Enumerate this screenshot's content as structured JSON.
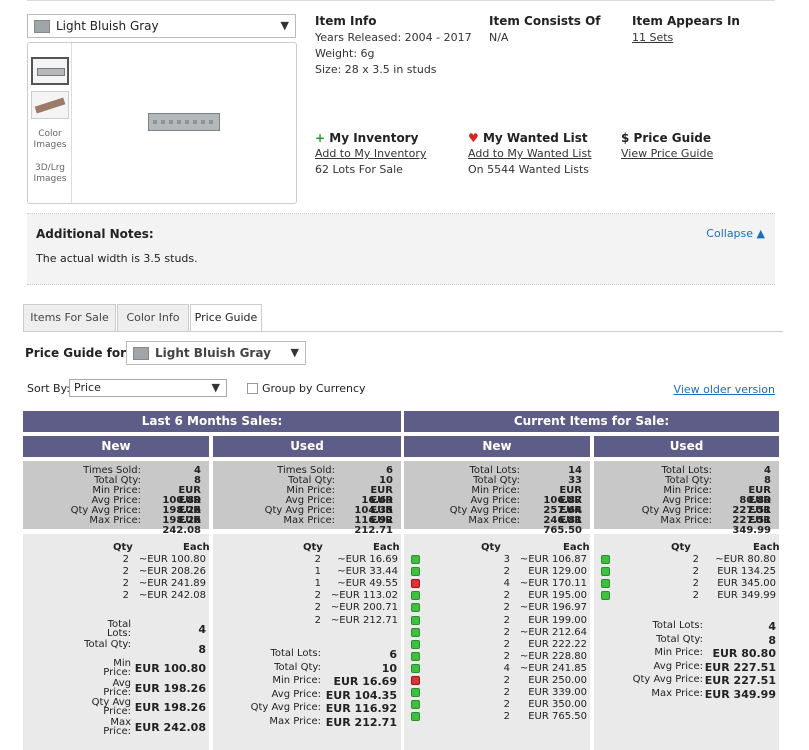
{
  "header": {
    "color_select": "Light Bluish Gray",
    "thumb_color_images": "Color Images",
    "thumb_3d_images": "3D/Lrg Images"
  },
  "item_info": {
    "title": "Item Info",
    "years": "Years Released: 2004 - 2017",
    "weight": "Weight: 6g",
    "size": "Size: 28 x 3.5 in studs"
  },
  "consists": {
    "title": "Item Consists Of",
    "value": "N/A"
  },
  "appears": {
    "title": "Item Appears In",
    "link": "11 Sets"
  },
  "inventory": {
    "icon": "+",
    "title": "My Inventory",
    "link": "Add to My Inventory",
    "sub": "62 Lots For Sale"
  },
  "wanted": {
    "icon": "♥",
    "title": "My Wanted List",
    "link": "Add to My Wanted List",
    "sub": "On 5544 Wanted Lists"
  },
  "price_guide_box": {
    "icon": "$",
    "title": "Price Guide",
    "link": "View Price Guide"
  },
  "notes": {
    "title": "Additional Notes:",
    "text": "The actual width is 3.5 studs.",
    "collapse": "Collapse ▲"
  },
  "tabs": [
    "Items For Sale",
    "Color Info",
    "Price Guide"
  ],
  "price_guide": {
    "title": "Price Guide for",
    "color": "Light Bluish Gray",
    "sort_label": "Sort By:",
    "sort_value": "Price",
    "group_label": "Group by Currency",
    "older_link": "View older version",
    "band_left": "Last 6 Months Sales:",
    "band_right": "Current Items for Sale:",
    "new_label": "New",
    "used_label": "Used"
  },
  "summary_labels": {
    "sold": [
      "Times Sold:",
      "Total Qty:",
      "Min Price:",
      "Avg Price:",
      "Qty Avg Price:",
      "Max Price:"
    ],
    "current": [
      "Total Lots:",
      "Total Qty:",
      "Min Price:",
      "Avg Price:",
      "Qty Avg Price:",
      "Max Price:"
    ]
  },
  "summaries": {
    "sold_new": [
      "4",
      "8",
      "EUR 100.80",
      "EUR 198.26",
      "EUR 198.26",
      "EUR 242.08"
    ],
    "sold_used": [
      "6",
      "10",
      "EUR 16.69",
      "EUR 104.35",
      "EUR 116.92",
      "EUR 212.71"
    ],
    "cur_new": [
      "14",
      "33",
      "EUR 106.87",
      "EUR 257.64",
      "EUR 246.81",
      "EUR 765.50"
    ],
    "cur_used": [
      "4",
      "8",
      "EUR 80.80",
      "EUR 227.51",
      "EUR 227.51",
      "EUR 349.99"
    ]
  },
  "detail_headers": {
    "qty": "Qty",
    "each": "Each"
  },
  "sold_new_rows": [
    [
      "2",
      "~EUR 100.80"
    ],
    [
      "2",
      "~EUR 208.26"
    ],
    [
      "2",
      "~EUR 241.89"
    ],
    [
      "2",
      "~EUR 242.08"
    ]
  ],
  "sold_used_rows": [
    [
      "2",
      "~EUR 16.69"
    ],
    [
      "1",
      "~EUR 33.44"
    ],
    [
      "1",
      "~EUR 49.55"
    ],
    [
      "2",
      "~EUR 113.02"
    ],
    [
      "2",
      "~EUR 200.71"
    ],
    [
      "2",
      "~EUR 212.71"
    ]
  ],
  "cur_new_rows": [
    [
      "g",
      "3",
      "~EUR 106.87"
    ],
    [
      "g",
      "2",
      "EUR 129.00"
    ],
    [
      "r",
      "4",
      "~EUR 170.11"
    ],
    [
      "g",
      "2",
      "EUR 195.00"
    ],
    [
      "g",
      "2",
      "~EUR 196.97"
    ],
    [
      "g",
      "2",
      "EUR 199.00"
    ],
    [
      "g",
      "2",
      "~EUR 212.64"
    ],
    [
      "g",
      "2",
      "EUR 222.22"
    ],
    [
      "g",
      "2",
      "~EUR 228.80"
    ],
    [
      "g",
      "4",
      "~EUR 241.85"
    ],
    [
      "r",
      "2",
      "EUR 250.00"
    ],
    [
      "g",
      "2",
      "EUR 339.00"
    ],
    [
      "g",
      "2",
      "EUR 350.00"
    ],
    [
      "g",
      "2",
      "EUR 765.50"
    ]
  ],
  "cur_used_rows": [
    [
      "g",
      "2",
      "~EUR 80.80"
    ],
    [
      "g",
      "2",
      "EUR 134.25"
    ],
    [
      "g",
      "2",
      "EUR 345.00"
    ],
    [
      "g",
      "2",
      "EUR 349.99"
    ]
  ],
  "sold_new_totals": {
    "labels": [
      "Total Lots:",
      "Total Qty:",
      "Min Price:",
      "Avg Price:",
      "Qty Avg Price:",
      "Max Price:"
    ],
    "values": [
      "4",
      "8",
      "EUR 100.80",
      "EUR 198.26",
      "EUR 198.26",
      "EUR 242.08"
    ]
  },
  "sold_used_totals": {
    "labels": [
      "Total Lots:",
      "Total Qty:",
      "Min Price:",
      "Avg Price:",
      "Qty Avg Price:",
      "Max Price:"
    ],
    "values": [
      "6",
      "10",
      "EUR 16.69",
      "EUR 104.35",
      "EUR 116.92",
      "EUR 212.71"
    ]
  },
  "cur_used_totals": {
    "labels": [
      "Total Lots:",
      "Total Qty:",
      "Min Price:",
      "Avg Price:",
      "Qty Avg Price:",
      "Max Price:"
    ],
    "values": [
      "4",
      "8",
      "EUR 80.80",
      "EUR 227.51",
      "EUR 227.51",
      "EUR 349.99"
    ]
  },
  "colors": {
    "header_band": "#5e5d87",
    "summary_bg": "#c8c8c8",
    "detail_bg": "#eaeaea",
    "link": "#1a6dc2",
    "color_swatch": "#a0a5a9"
  }
}
